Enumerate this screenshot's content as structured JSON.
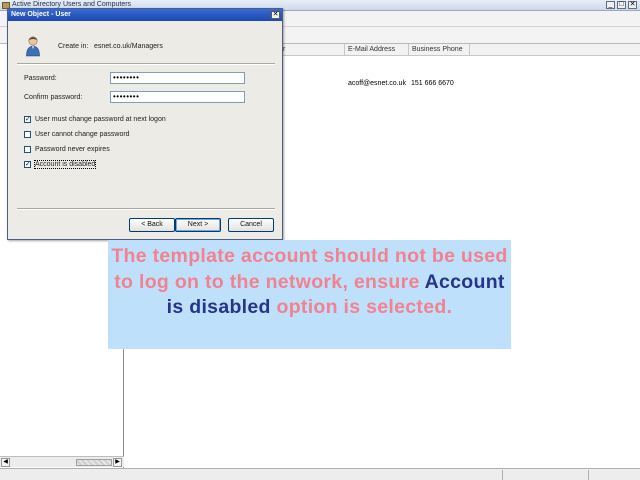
{
  "main_window": {
    "title": "Active Directory Users and Computers",
    "controls": {
      "minimize": "_",
      "maximize": "□",
      "close": "✕"
    },
    "list_columns": [
      "",
      "",
      "r",
      "E-Mail Address",
      "Business Phone",
      ""
    ],
    "list_row": {
      "email": "acoff@esnet.co.uk",
      "phone": "151 666 6670"
    },
    "tree_scroll": {
      "left_arrow": "◀",
      "right_arrow": "▶"
    }
  },
  "dialog": {
    "title": "New Object - User",
    "close_glyph": "✕",
    "created_in_label": "Create in:",
    "created_in_value": "esnet.co.uk/Managers",
    "password_label": "Password:",
    "password_value": "••••••••",
    "confirm_label": "Confirm password:",
    "confirm_value": "••••••••",
    "options": [
      {
        "label": "User must change password at next logon",
        "checked": true,
        "mark": "✓"
      },
      {
        "label": "User cannot change password",
        "checked": false,
        "mark": ""
      },
      {
        "label": "Password never expires",
        "checked": false,
        "mark": ""
      },
      {
        "label": "Account is disabled",
        "checked": true,
        "mark": "✓"
      }
    ],
    "buttons": {
      "back": "< Back",
      "next": "Next >",
      "cancel": "Cancel"
    }
  },
  "callout": {
    "part1": "The template account should not be used to log on to the network, ensure",
    "highlight": "Account is disabled",
    "part2": "option is selected.",
    "text_color": "#f1828f",
    "highlight_color": "#25348c",
    "background": "#bfe0fb"
  }
}
